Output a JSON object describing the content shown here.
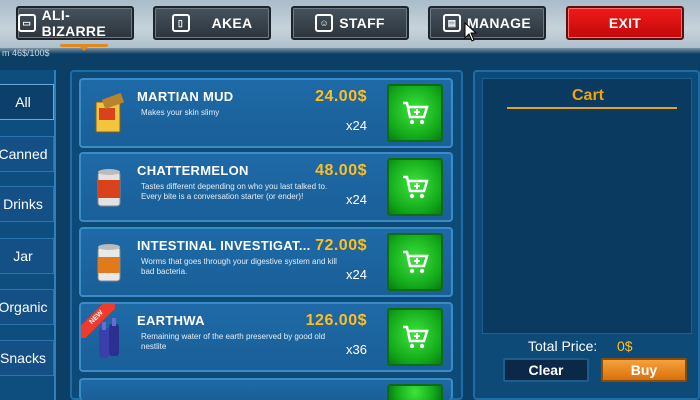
{
  "topbar": {
    "buttons": [
      {
        "label": "ALI-BIZARRE",
        "icon": "laptop-icon"
      },
      {
        "label": "AKEA",
        "icon": "cabinet-icon"
      },
      {
        "label": "STAFF",
        "icon": "staff-icon"
      },
      {
        "label": "MANAGE",
        "icon": "manage-icon"
      },
      {
        "label": "EXIT"
      }
    ],
    "balance": "m 46$/100$"
  },
  "categories": [
    "All",
    "Canned",
    "Drinks",
    "Jar",
    "Organic",
    "Snacks"
  ],
  "products": [
    {
      "name": "MARTIAN MUD",
      "description": "Makes your skin slimy",
      "price": "24.00$",
      "qty": "x24",
      "icon": "mud-box-icon"
    },
    {
      "name": "CHATTERMELON",
      "description": "Tastes different depending on who you last talked to.  Every bite is a conversation starter (or ender)!",
      "price": "48.00$",
      "qty": "x24",
      "icon": "can-icon"
    },
    {
      "name": "INTESTINAL INVESTIGAT...",
      "description": "Worms that goes through your digestive system and kill bad bacteria.",
      "price": "72.00$",
      "qty": "x24",
      "icon": "can-icon"
    },
    {
      "name": "EARTHWA",
      "description": "Remaining water of the earth preserved by good old nestlite",
      "price": "126.00$",
      "qty": "x36",
      "icon": "bottle-icon",
      "badge": "NEW"
    }
  ],
  "cart": {
    "title": "Cart",
    "total_label": "Total Price:",
    "total_value": "0$",
    "clear_label": "Clear",
    "buy_label": "Buy"
  },
  "colors": {
    "background": "#0b3f66",
    "price": "#ffbf1f",
    "add_button": "#22c42a",
    "exit": "#e01111",
    "buy": "#f08a1c"
  }
}
